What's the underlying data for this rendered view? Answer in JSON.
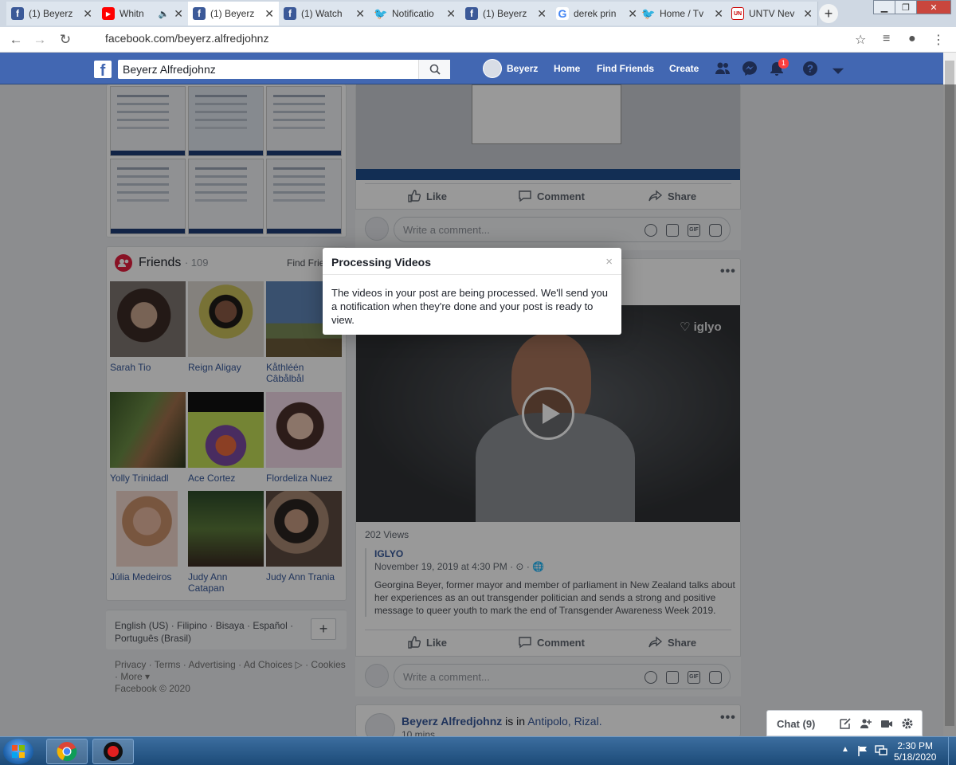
{
  "browser": {
    "tabs": [
      {
        "title": "(1) Beyerz",
        "favicon": "facebook-icon",
        "active": false
      },
      {
        "title": "Whitn",
        "favicon": "youtube-icon",
        "active": false,
        "audio": true
      },
      {
        "title": "(1) Beyerz",
        "favicon": "facebook-icon",
        "active": true
      },
      {
        "title": "(1) Watch",
        "favicon": "facebook-icon",
        "active": false
      },
      {
        "title": "Notificatio",
        "favicon": "twitter-icon",
        "active": false
      },
      {
        "title": "(1) Beyerz",
        "favicon": "facebook-icon",
        "active": false
      },
      {
        "title": "derek prin",
        "favicon": "google-icon",
        "active": false
      },
      {
        "title": "Home / Tv",
        "favicon": "twitter-icon",
        "active": false
      },
      {
        "title": "UNTV Nev",
        "favicon": "untv-icon",
        "active": false
      }
    ],
    "url": "facebook.com/beyerz.alfredjohnz"
  },
  "fb_header": {
    "search_value": "Beyerz Alfredjohnz",
    "profile_name": "Beyerz",
    "nav": [
      "Home",
      "Find Friends",
      "Create"
    ],
    "notification_count": "1",
    "brand_color": "#4267b2"
  },
  "friends": {
    "title": "Friends",
    "count": "· 109",
    "find_friends": "Find Frie",
    "list": [
      {
        "name": "Sarah Tio"
      },
      {
        "name": "Reign Aligay"
      },
      {
        "name": "Kåthléén Câbålbål"
      },
      {
        "name": "Yolly Trinidadl"
      },
      {
        "name": "Ace Cortez"
      },
      {
        "name": "Flordeliza Nuez"
      },
      {
        "name": "Júlia Medeiros"
      },
      {
        "name": "Judy Ann Catapan"
      },
      {
        "name": "Judy Ann Trania"
      }
    ]
  },
  "languages": {
    "line1": "English (US) · Filipino · Bisaya · Español ·",
    "line2": "Português (Brasil)",
    "add": "+"
  },
  "footer": {
    "line1": "Privacy · Terms · Advertising · Ad Choices ▷ · Cookies",
    "line2": "· More ▾",
    "line3": "Facebook © 2020"
  },
  "post_actions": {
    "like": "Like",
    "comment": "Comment",
    "share": "Share"
  },
  "comment_placeholder": "Write a comment...",
  "shared_post": {
    "views": "202 Views",
    "page": "IGLYO",
    "date": "November 19, 2019 at 4:30 PM · ⊙ ·",
    "text": "Georgina Beyer, former mayor and member of parliament in New Zealand talks about her experiences as an out transgender politician and sends a strong and positive message to queer youth to mark the end of Transgender Awareness Week 2019.",
    "video_brand": "iglyo"
  },
  "next_post": {
    "author": "Beyerz Alfredjohnz",
    "verb": "is in",
    "place": "Antipolo, Rizal.",
    "time": "10 mins"
  },
  "modal": {
    "title": "Processing Videos",
    "close": "×",
    "body": "The videos in your post are being processed. We'll send you a notification when they're done and your post is ready to view."
  },
  "chat": {
    "label": "Chat (9)"
  },
  "taskbar": {
    "time": "2:30 PM",
    "date": "5/18/2020"
  }
}
